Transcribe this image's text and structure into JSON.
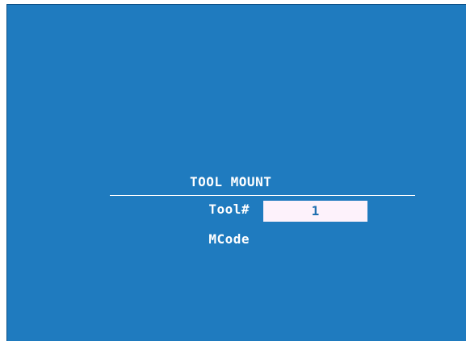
{
  "colors": {
    "screen_background": "#1f7bbf",
    "text": "#ffffff",
    "field_background": "#fdf2fb",
    "field_text": "#1f6fb0"
  },
  "dialog": {
    "title": "TOOL MOUNT",
    "fields": [
      {
        "label": "Tool#",
        "value": "1"
      },
      {
        "label": "MCode",
        "value": ""
      }
    ]
  }
}
